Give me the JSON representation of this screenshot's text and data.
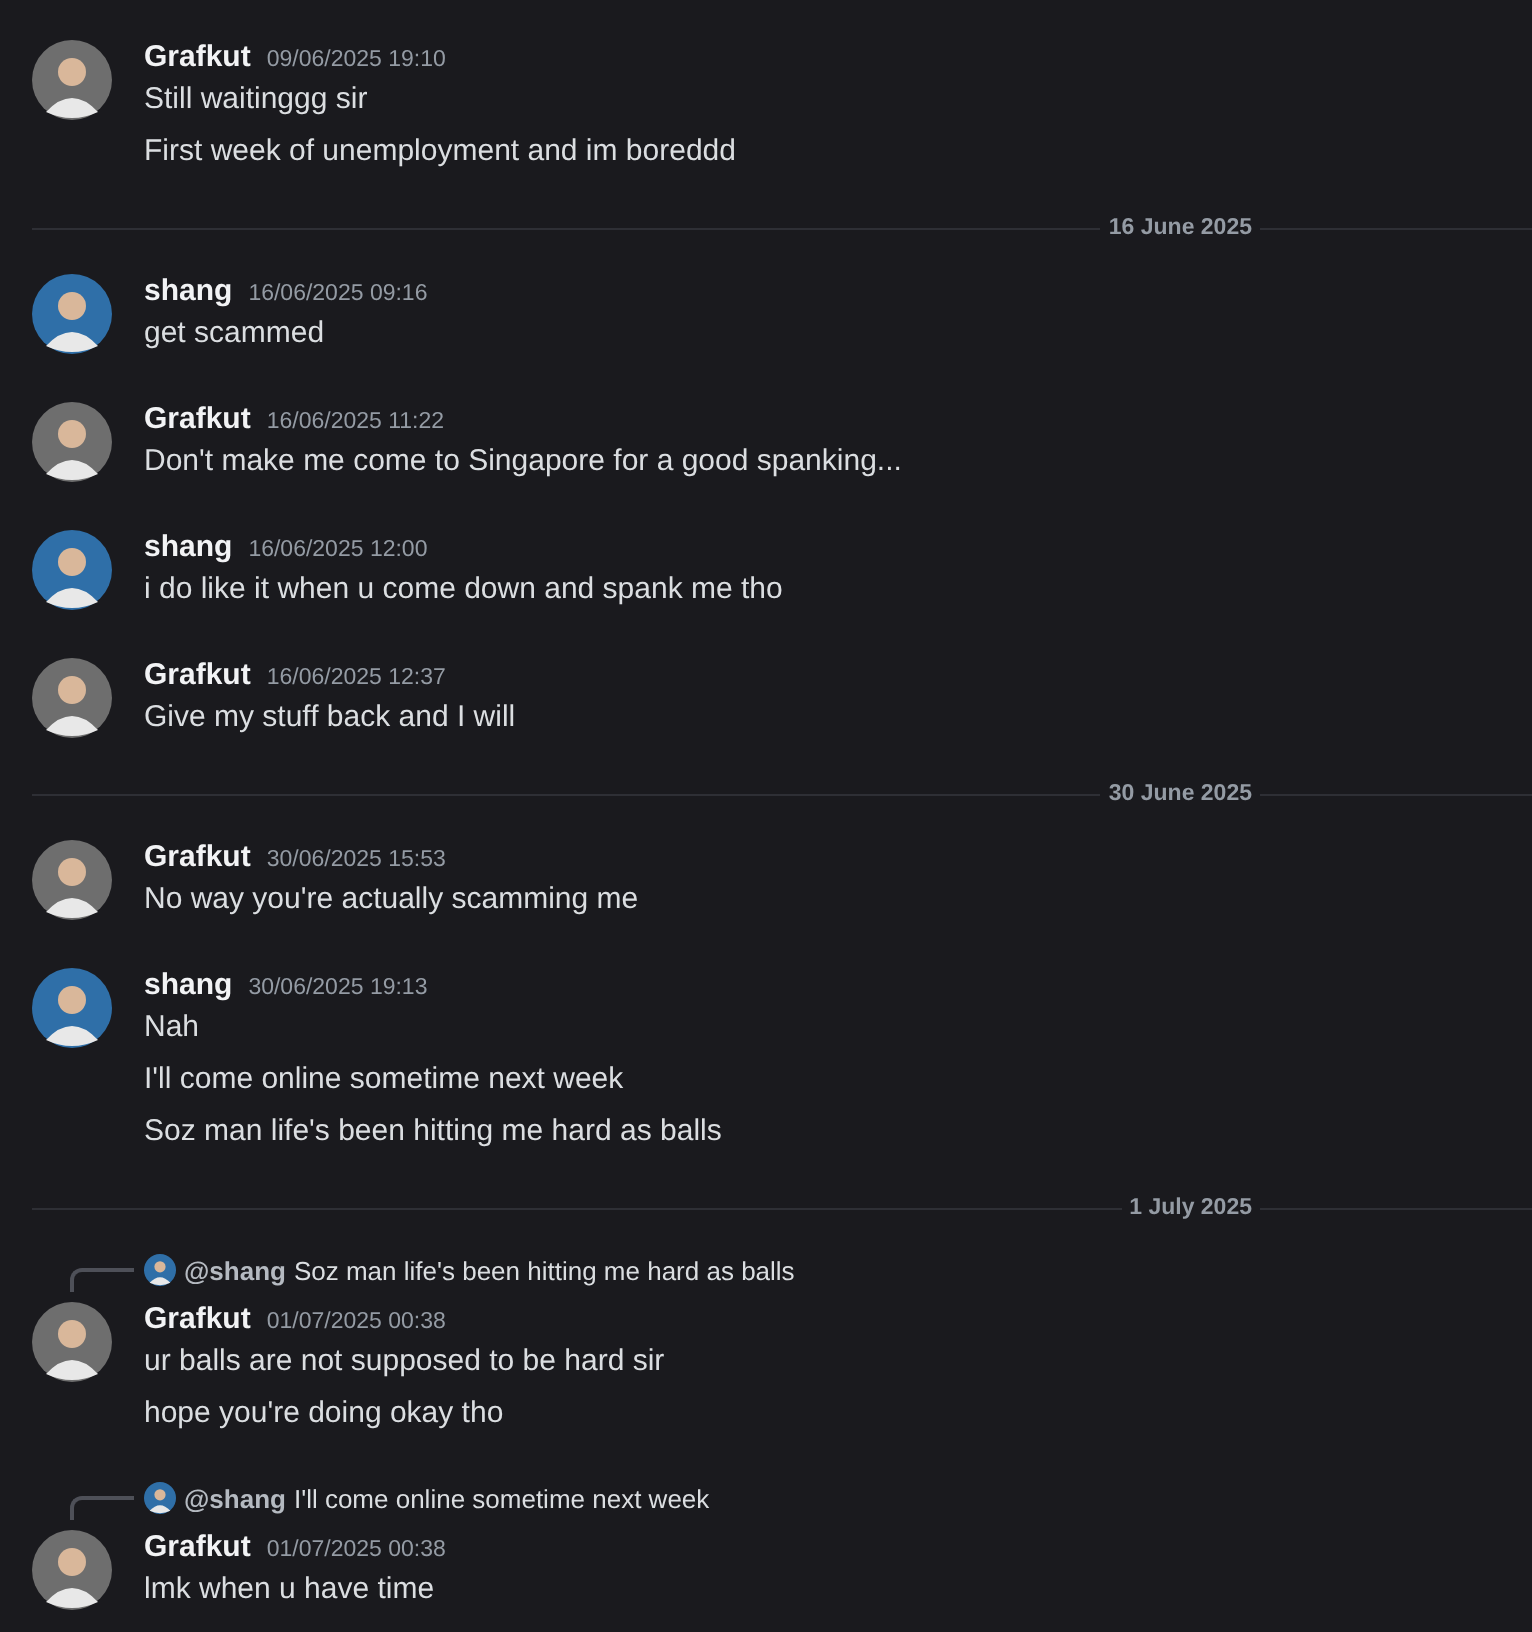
{
  "feed": [
    {
      "kind": "message",
      "author": "Grafkut",
      "timestamp": "09/06/2025 19:10",
      "color": "#6e6e6e",
      "lines": [
        "Still waitinggg sir",
        "First week of unemployment and im boreddd"
      ]
    },
    {
      "kind": "divider",
      "label": "16 June 2025"
    },
    {
      "kind": "message",
      "author": "shang",
      "timestamp": "16/06/2025 09:16",
      "color": "#2f6fa8",
      "lines": [
        "get scammed"
      ]
    },
    {
      "kind": "message",
      "author": "Grafkut",
      "timestamp": "16/06/2025 11:22",
      "color": "#6e6e6e",
      "lines": [
        "Don't make me come to Singapore for a good spanking..."
      ]
    },
    {
      "kind": "message",
      "author": "shang",
      "timestamp": "16/06/2025 12:00",
      "color": "#2f6fa8",
      "lines": [
        "i do like it when u come down and spank me tho"
      ]
    },
    {
      "kind": "message",
      "author": "Grafkut",
      "timestamp": "16/06/2025 12:37",
      "color": "#6e6e6e",
      "lines": [
        "Give my stuff back and I will"
      ]
    },
    {
      "kind": "divider",
      "label": "30 June 2025"
    },
    {
      "kind": "message",
      "author": "Grafkut",
      "timestamp": "30/06/2025 15:53",
      "color": "#6e6e6e",
      "lines": [
        "No way you're actually scamming me"
      ]
    },
    {
      "kind": "message",
      "author": "shang",
      "timestamp": "30/06/2025 19:13",
      "color": "#2f6fa8",
      "lines": [
        "Nah",
        "I'll come online sometime next week",
        "Soz man life's been hitting me hard as balls"
      ]
    },
    {
      "kind": "divider",
      "label": "1 July 2025"
    },
    {
      "kind": "message",
      "author": "Grafkut",
      "timestamp": "01/07/2025 00:38",
      "color": "#6e6e6e",
      "reply": {
        "author": "@shang",
        "text": "Soz man life's been hitting me hard as balls",
        "color": "#2f6fa8"
      },
      "lines": [
        "ur balls are not supposed to be hard sir",
        "hope you're doing okay tho"
      ]
    },
    {
      "kind": "message",
      "author": "Grafkut",
      "timestamp": "01/07/2025 00:38",
      "color": "#6e6e6e",
      "reply": {
        "author": "@shang",
        "text": "I'll come online sometime next week",
        "color": "#2f6fa8"
      },
      "lines": [
        "lmk when u have time"
      ]
    }
  ]
}
